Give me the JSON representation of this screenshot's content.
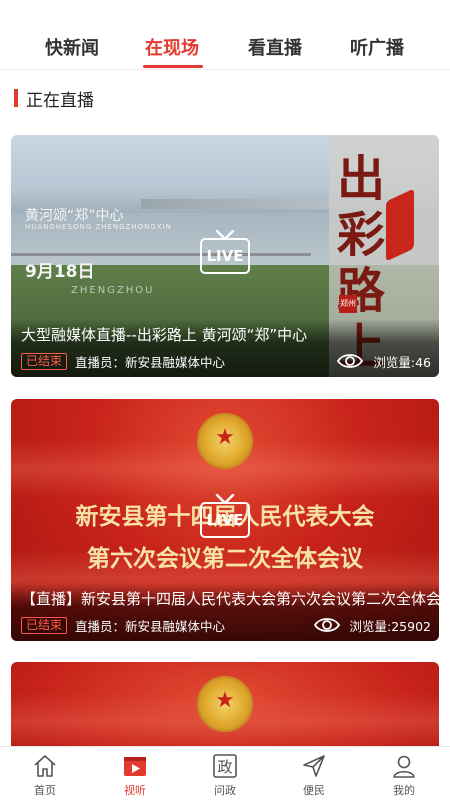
{
  "tabs": [
    {
      "label": "快新闻",
      "active": false
    },
    {
      "label": "在现场",
      "active": true
    },
    {
      "label": "看直播",
      "active": false
    },
    {
      "label": "听广播",
      "active": false
    }
  ],
  "section_title": "正在直播",
  "live_badge": "LIVE",
  "cards": [
    {
      "title": "大型融媒体直播--出彩路上 黄河颂“郑”中心",
      "status": "已结束",
      "anchor": "直播员：新安县融媒体中心",
      "views": "浏览量:46",
      "image_text": {
        "headline": "黄河颂“郑”中心",
        "pinyin": "HUANGHESONG ZHENGZHONGXIN",
        "date": "9月18日",
        "city": "ZHENGZHOU",
        "calligraphy": "出彩路上",
        "tag": "郑州"
      }
    },
    {
      "title": "【直播】新安县第十四届人民代表大会第六次会议第二次全体会议",
      "status": "已结束",
      "anchor": "直播员：新安县融媒体中心",
      "views": "浏览量:25902",
      "image_text": {
        "line1": "新安县第十四届人民代表大会",
        "line2": "第六次会议第二次全体会议"
      }
    }
  ],
  "bottom_nav": [
    {
      "label": "首页",
      "icon": "home-icon",
      "active": false
    },
    {
      "label": "视听",
      "icon": "video-icon",
      "active": true
    },
    {
      "label": "问政",
      "icon": "politics-icon",
      "active": false
    },
    {
      "label": "便民",
      "icon": "send-icon",
      "active": false
    },
    {
      "label": "我的",
      "icon": "user-icon",
      "active": false
    }
  ],
  "colors": {
    "accent": "#e23a2e",
    "status": "#ff5a4a"
  }
}
